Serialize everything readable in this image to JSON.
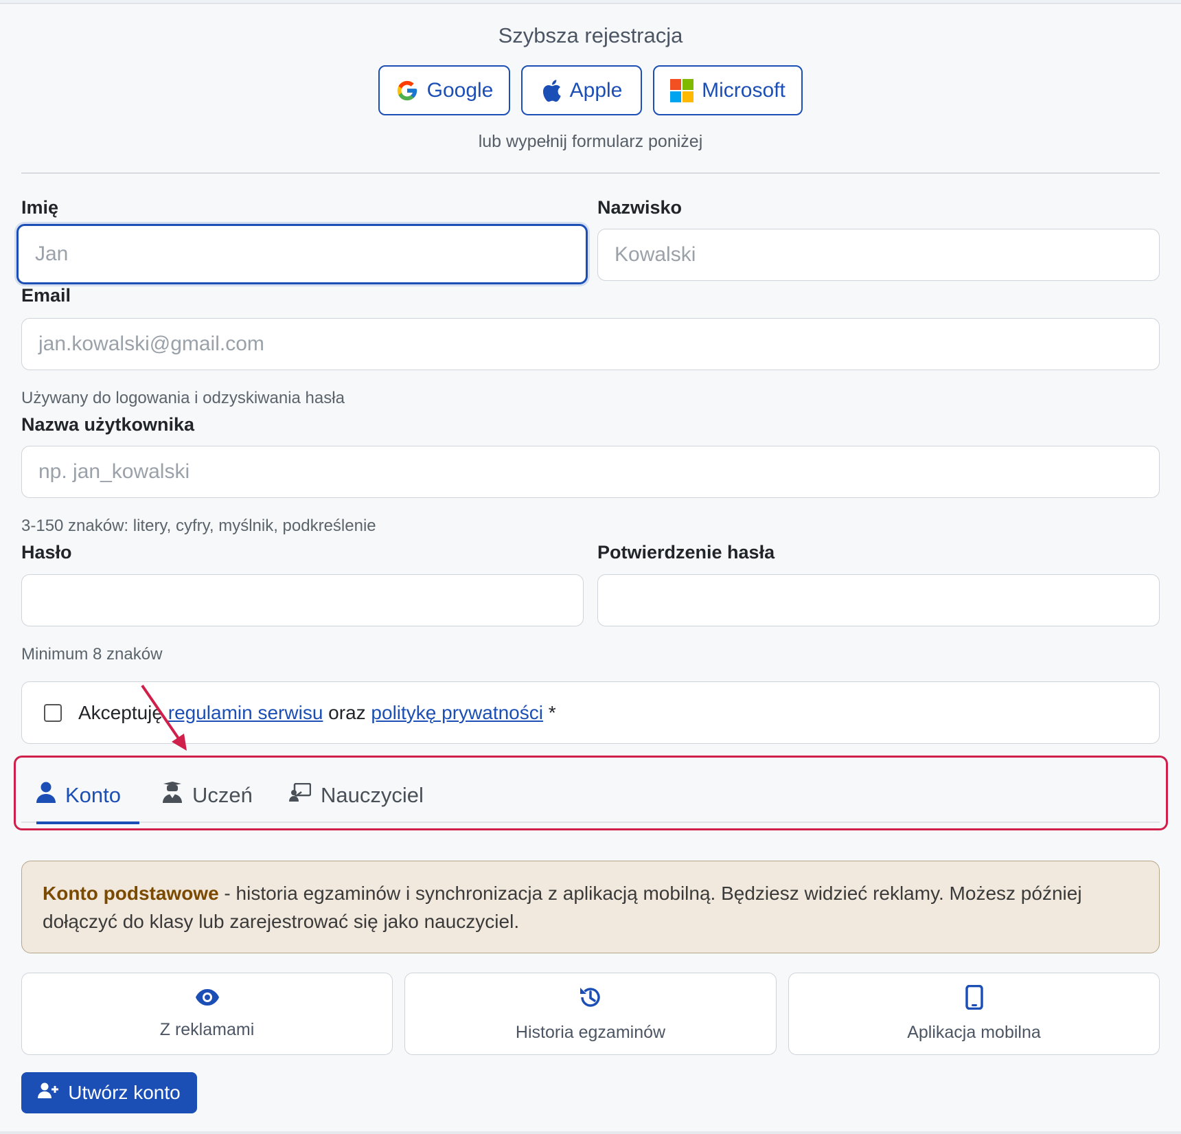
{
  "social": {
    "title": "Szybsza rejestracja",
    "buttons": [
      {
        "label": "Google",
        "icon": "google-icon"
      },
      {
        "label": "Apple",
        "icon": "apple-icon"
      },
      {
        "label": "Microsoft",
        "icon": "microsoft-icon"
      }
    ],
    "or_text": "lub wypełnij formularz poniżej"
  },
  "form": {
    "first_name": {
      "label": "Imię",
      "placeholder": "Jan",
      "value": ""
    },
    "last_name": {
      "label": "Nazwisko",
      "placeholder": "Kowalski",
      "value": ""
    },
    "email": {
      "label": "Email",
      "placeholder": "jan.kowalski@gmail.com",
      "value": "",
      "help": "Używany do logowania i odzyskiwania hasła"
    },
    "username": {
      "label": "Nazwa użytkownika",
      "placeholder": "np. jan_kowalski",
      "value": "",
      "help": "3-150 znaków: litery, cyfry, myślnik, podkreślenie"
    },
    "password": {
      "label": "Hasło",
      "value": "",
      "help": "Minimum 8 znaków"
    },
    "password_confirm": {
      "label": "Potwierdzenie hasła",
      "value": ""
    }
  },
  "terms": {
    "prefix": "Akceptuję ",
    "link1": "regulamin serwisu",
    "middle": " oraz ",
    "link2": "politykę prywatności",
    "suffix": " *",
    "checked": false
  },
  "tabs": [
    {
      "label": "Konto",
      "icon": "user-icon",
      "active": true
    },
    {
      "label": "Uczeń",
      "icon": "graduate-icon",
      "active": false
    },
    {
      "label": "Nauczyciel",
      "icon": "teacher-icon",
      "active": false
    }
  ],
  "info": {
    "strong": "Konto podstawowe",
    "text": " - historia egzaminów i synchronizacja z aplikacją mobilną. Będziesz widzieć reklamy. Możesz później dołączyć do klasy lub zarejestrować się jako nauczyciel."
  },
  "features": [
    {
      "label": "Z reklamami",
      "icon": "eye-icon"
    },
    {
      "label": "Historia egzaminów",
      "icon": "history-icon"
    },
    {
      "label": "Aplikacja mobilna",
      "icon": "mobile-icon"
    }
  ],
  "submit": {
    "label": "Utwórz konto",
    "icon": "user-plus-icon"
  },
  "colors": {
    "primary": "#1b4fb5",
    "highlight": "#d01f4a",
    "info_bg": "#f2e9de"
  }
}
